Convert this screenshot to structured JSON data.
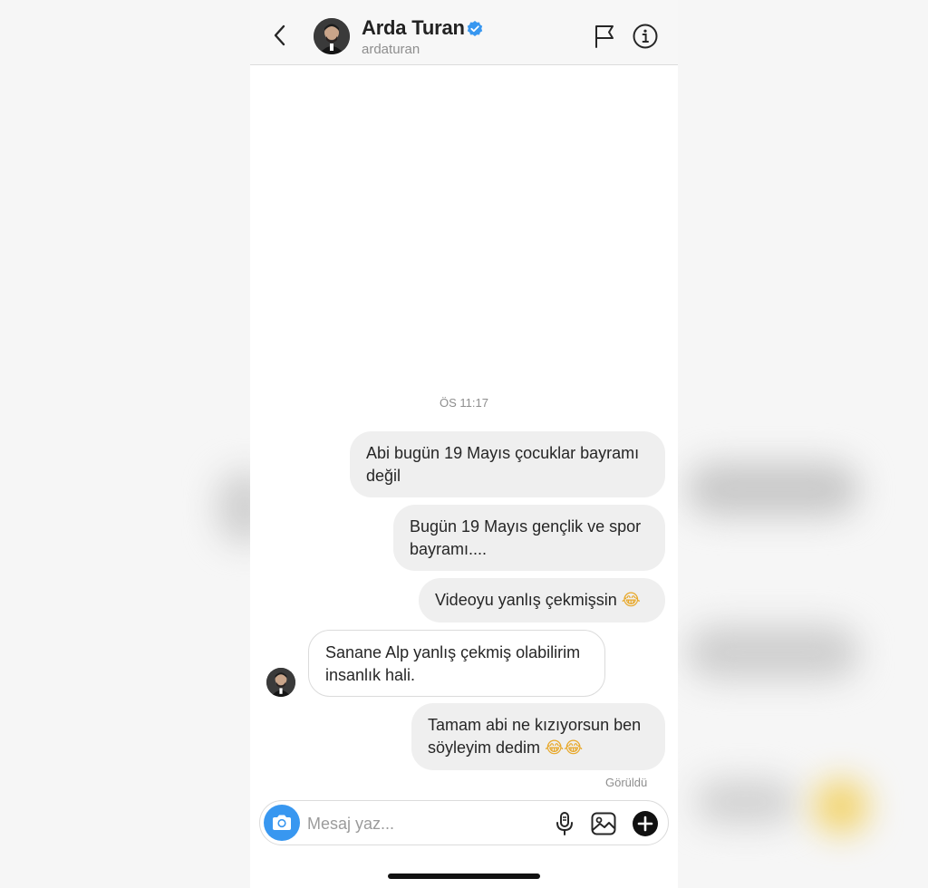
{
  "header": {
    "back_label": "",
    "name": "Arda Turan",
    "handle": "ardaturan",
    "verified": true
  },
  "conversation": {
    "timestamp": "ÖS 11:17",
    "messages": [
      {
        "from": "me",
        "line1": "Abi bugün 19 Mayıs çocuklar bayramı",
        "line2": "değil"
      },
      {
        "from": "me",
        "line1": "Bugün 19 Mayıs gençlik ve spor",
        "line2": "bayramı...."
      },
      {
        "from": "me",
        "line1": "Videoyu yanlış çekmişsin",
        "emoji": "😂"
      },
      {
        "from": "them",
        "line1": "Sanane Alp yanlış çekmiş olabilirim",
        "line2": "insanlık hali."
      },
      {
        "from": "me",
        "line1": "Tamam abi ne kızıyorsun ben",
        "line2": "söyleyim dedim",
        "emoji": "😂😂"
      }
    ],
    "seen_label": "Görüldü"
  },
  "composer": {
    "placeholder": "Mesaj yaz...",
    "value": ""
  },
  "icons": {
    "back": "chevron-left-icon",
    "verified": "verified-badge-icon",
    "flag": "flag-icon",
    "info": "info-icon",
    "camera": "camera-icon",
    "mic": "microphone-icon",
    "gallery": "image-icon",
    "plus": "plus-circle-icon"
  },
  "colors": {
    "accent": "#3897f0",
    "sent_bubble": "#efefef",
    "received_bubble_border": "#dbdbdb",
    "meta_text": "#8e8e8e"
  }
}
